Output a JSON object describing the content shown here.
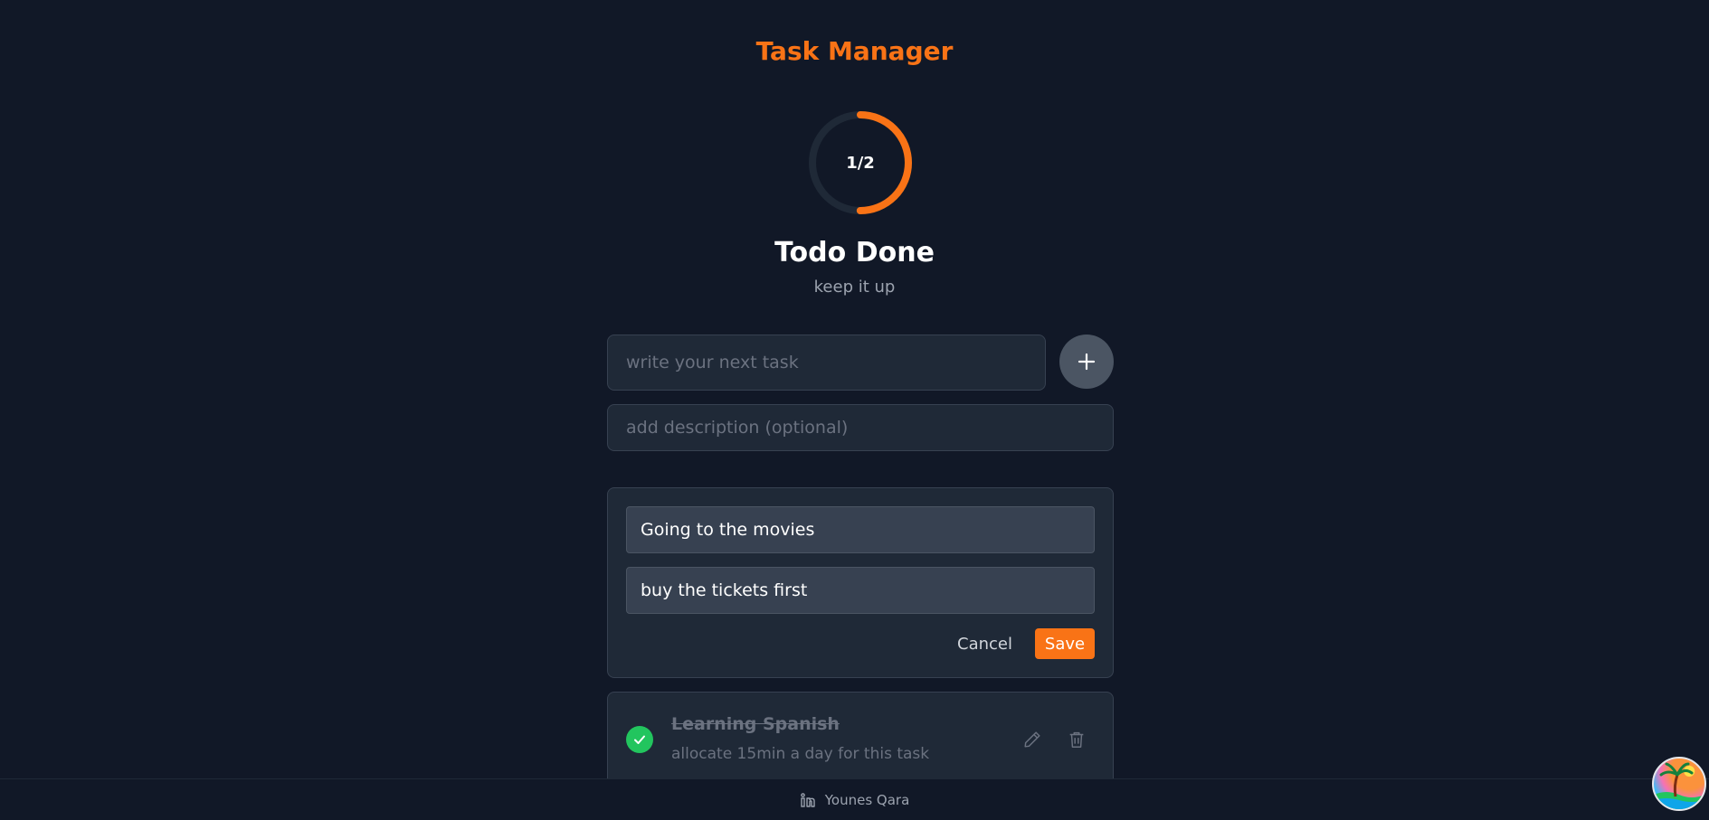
{
  "header": {
    "title": "Task Manager"
  },
  "progress": {
    "done": 1,
    "total": 2,
    "label": "1/2",
    "ring_color": "#f97316",
    "track_color": "#1f2937"
  },
  "status": {
    "heading": "Todo Done",
    "subtext": "keep it up"
  },
  "new_task": {
    "task_placeholder": "write your next task",
    "task_value": "",
    "description_placeholder": "add description (optional)",
    "description_value": "",
    "add_icon": "plus-icon"
  },
  "editor": {
    "title_value": "Going to the movies",
    "description_value": "buy the tickets first",
    "cancel_label": "Cancel",
    "save_label": "Save"
  },
  "tasks": [
    {
      "title": "Learning Spanish",
      "description": "allocate 15min a day for this task",
      "completed": true,
      "edit_icon": "pencil-icon",
      "delete_icon": "trash-icon"
    }
  ],
  "footer": {
    "author": "Younes Qara",
    "icon": "linkedin-icon"
  },
  "colors": {
    "accent": "#f97316",
    "background": "#111827",
    "card": "#1f2937",
    "success": "#22c55e"
  }
}
